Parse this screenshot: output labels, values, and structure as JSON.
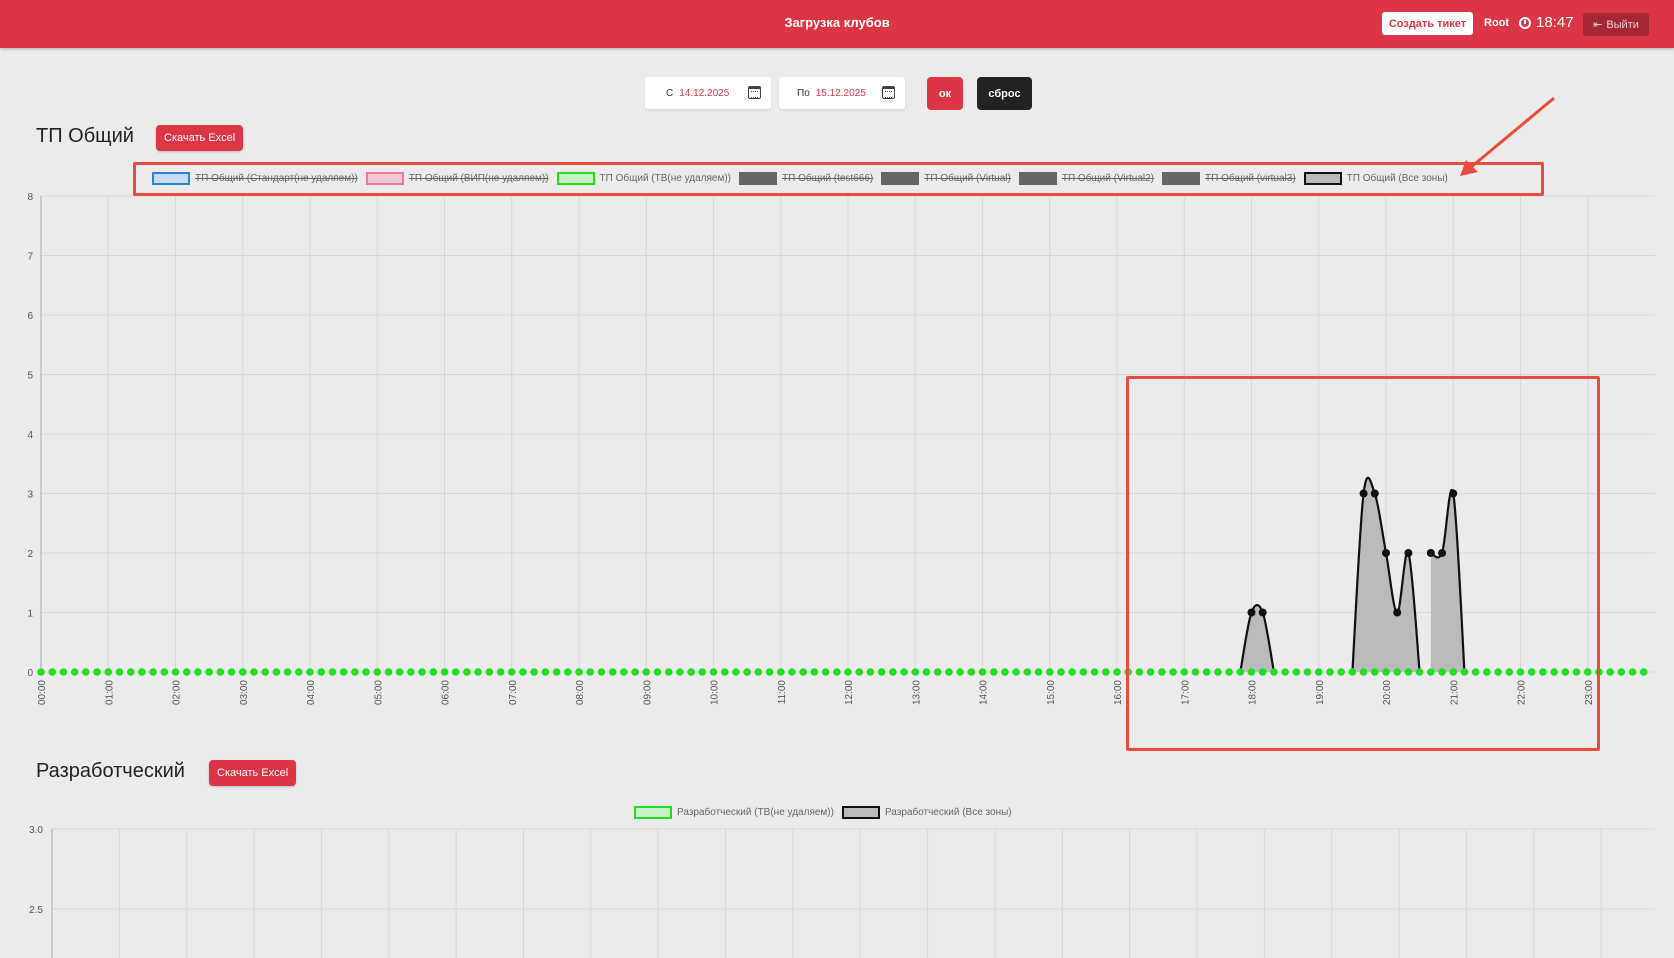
{
  "header": {
    "title": "Загрузка клубов",
    "create_ticket": "Создать тикет",
    "user": "Root",
    "time": "18:47",
    "logout": "Выйти"
  },
  "filter": {
    "from_prefix": "С",
    "from_value": "14.12.2025",
    "to_prefix": "По",
    "to_value": "15.12.2025",
    "ok": "ок",
    "reset": "сброс"
  },
  "sections": [
    {
      "title": "ТП Общий",
      "excel": "Скачать Excel",
      "legend": [
        {
          "label": "ТП Общий (Стандарт(не удаляем))",
          "fill": "#c6dcef",
          "border": "#2b83d3",
          "hidden": true
        },
        {
          "label": "ТП Общий (ВИП(не удаляем))",
          "fill": "#f4c8d2",
          "border": "#f0799a",
          "hidden": true
        },
        {
          "label": "ТП Общий (ТВ(не удаляем))",
          "fill": "#c6f3c6",
          "border": "#22dd22",
          "hidden": false
        },
        {
          "label": "ТП Общий (test666)",
          "fill": "#666666",
          "border": "#666666",
          "hidden": true
        },
        {
          "label": "ТП Общий (Virtual)",
          "fill": "#666666",
          "border": "#666666",
          "hidden": true
        },
        {
          "label": "ТП Общий (Virtual2)",
          "fill": "#666666",
          "border": "#666666",
          "hidden": true
        },
        {
          "label": "ТП Общий (virtual3)",
          "fill": "#666666",
          "border": "#666666",
          "hidden": true
        },
        {
          "label": "ТП Общий (Все зоны)",
          "fill": "#bbbbbb",
          "border": "#111111",
          "hidden": false
        }
      ]
    },
    {
      "title": "Разработческий",
      "excel": "Скачать Excel",
      "legend": [
        {
          "label": "Разработческий (ТВ(не удаляем))",
          "fill": "#c6f3c6",
          "border": "#22dd22",
          "hidden": false
        },
        {
          "label": "Разработческий (Все зоны)",
          "fill": "#bbbbbb",
          "border": "#111111",
          "hidden": false
        }
      ]
    }
  ],
  "chart_data": [
    {
      "type": "area",
      "x_labels": [
        "00:00",
        "01:00",
        "02:00",
        "03:00",
        "04:00",
        "05:00",
        "06:00",
        "07:00",
        "08:00",
        "09:00",
        "10:00",
        "11:00",
        "12:00",
        "13:00",
        "14:00",
        "15:00",
        "16:00",
        "17:00",
        "18:00",
        "19:00",
        "20:00",
        "21:00",
        "22:00",
        "23:00"
      ],
      "ylim": [
        0,
        8
      ],
      "y_ticks": [
        0,
        1,
        2,
        3,
        4,
        5,
        6,
        7,
        8
      ],
      "grid": true,
      "legend_position": "top",
      "series": [
        {
          "name": "ТП Общий (ТВ(не удаляем))",
          "color": "#22dd22",
          "values": "all zero, one point every 10 minutes from 00:00 to 23:50"
        },
        {
          "name": "ТП Общий (Все зоны)",
          "color": "#111111",
          "fill": "#bbbbbb",
          "points": [
            {
              "x": "17:50",
              "y": 0
            },
            {
              "x": "18:00",
              "y": 1
            },
            {
              "x": "18:10",
              "y": 1
            },
            {
              "x": "18:20",
              "y": 0
            },
            {
              "x": "19:30",
              "y": 0
            },
            {
              "x": "19:40",
              "y": 3
            },
            {
              "x": "19:50",
              "y": 3
            },
            {
              "x": "20:00",
              "y": 2
            },
            {
              "x": "20:10",
              "y": 1
            },
            {
              "x": "20:20",
              "y": 2
            },
            {
              "x": "20:30",
              "y": 0
            },
            {
              "x": "20:40",
              "y": 2
            },
            {
              "x": "20:50",
              "y": 2
            },
            {
              "x": "21:00",
              "y": 3
            },
            {
              "x": "21:10",
              "y": 0
            }
          ]
        }
      ]
    },
    {
      "type": "area",
      "ylim": [
        0,
        3
      ],
      "y_ticks": [
        3.0,
        2.5
      ],
      "grid": true,
      "legend_position": "top",
      "series": [
        {
          "name": "Разработческий (ТВ(не удаляем))",
          "color": "#22dd22"
        },
        {
          "name": "Разработческий (Все зоны)",
          "color": "#111111"
        }
      ]
    }
  ]
}
